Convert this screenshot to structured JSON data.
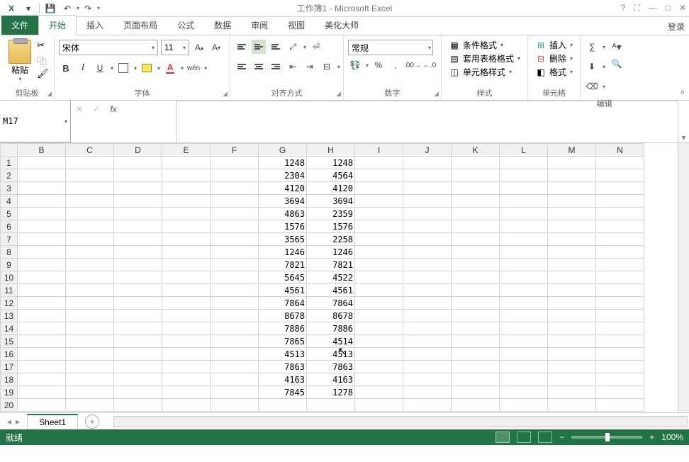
{
  "title": "工作簿1 - Microsoft Excel",
  "login": "登录",
  "tabs": {
    "file": "文件",
    "home": "开始",
    "insert": "插入",
    "layout": "页面布局",
    "formula": "公式",
    "data": "数据",
    "review": "审阅",
    "view": "视图",
    "beautify": "美化大师"
  },
  "ribbon": {
    "clipboard": {
      "paste": "粘贴",
      "label": "剪贴板"
    },
    "font": {
      "name": "宋体",
      "size": "11",
      "wen": "wén",
      "label": "字体"
    },
    "align": {
      "label": "对齐方式"
    },
    "number": {
      "format": "常规",
      "label": "数字"
    },
    "styles": {
      "cond": "条件格式",
      "table": "套用表格格式",
      "cell": "单元格样式",
      "label": "样式"
    },
    "cells": {
      "insert": "插入",
      "delete": "删除",
      "format": "格式",
      "label": "单元格"
    },
    "edit": {
      "label": "编辑"
    }
  },
  "namebox": "M17",
  "columns": [
    "B",
    "C",
    "D",
    "E",
    "F",
    "G",
    "H",
    "I",
    "J",
    "K",
    "L",
    "M",
    "N"
  ],
  "rows": [
    1,
    2,
    3,
    4,
    5,
    6,
    7,
    8,
    9,
    10,
    11,
    12,
    13,
    14,
    15,
    16,
    17,
    18,
    19,
    20
  ],
  "cells": {
    "G": [
      1248,
      2304,
      4120,
      3694,
      4863,
      1576,
      3565,
      1246,
      7821,
      5645,
      4561,
      7864,
      8678,
      7886,
      7865,
      4513,
      7863,
      4163,
      7845
    ],
    "H": [
      1248,
      4564,
      4120,
      3694,
      2359,
      1576,
      2258,
      1246,
      7821,
      4522,
      4561,
      7864,
      8678,
      7886,
      4514,
      4513,
      7863,
      4163,
      1278
    ]
  },
  "sheet": {
    "name": "Sheet1"
  },
  "status": {
    "ready": "就绪",
    "zoom": "100%"
  }
}
